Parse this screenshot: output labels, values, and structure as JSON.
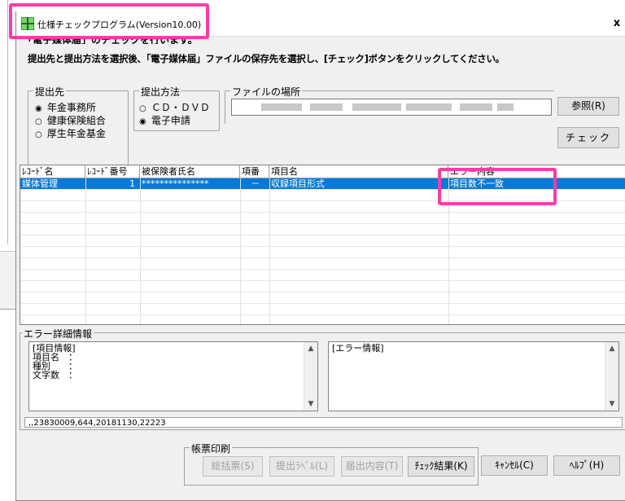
{
  "window": {
    "title": "仕様チェックプログラム(Version10.00)",
    "close_label": "x"
  },
  "description": {
    "line1": "「電子媒体届」のチェックを行います。",
    "line2": "提出先と提出方法を選択後、「電子媒体届」ファイルの保存先を選択し、[チェック]ボタンをクリックしてください。"
  },
  "submit_to": {
    "label": "提出先",
    "options": [
      {
        "label": "年金事務所",
        "selected": true
      },
      {
        "label": "健康保険組合",
        "selected": false
      },
      {
        "label": "厚生年金基金",
        "selected": false
      }
    ]
  },
  "submit_method": {
    "label": "提出方法",
    "options": [
      {
        "label": "ＣＤ・ＤＶＤ",
        "selected": false
      },
      {
        "label": "電子申請",
        "selected": true
      }
    ]
  },
  "file_location": {
    "label": "ファイルの場所",
    "browse_label": "参照(R)"
  },
  "check_button_label": "チェック",
  "table": {
    "headers": [
      "ﾚｺｰﾄﾞ名",
      "ﾚｺｰﾄﾞ番号",
      "被保険者氏名",
      "項番",
      "項目名",
      "エラー内容"
    ],
    "rows": [
      {
        "record_name": "媒体管理",
        "record_no": "1",
        "insured_name": "***************",
        "item_no": "－",
        "item_name": "収録項目形式",
        "error": "項目数不一致"
      }
    ]
  },
  "error_detail": {
    "label": "エラー詳細情報",
    "item_info": [
      "[項目情報]",
      "項目名　：",
      "種別　　：",
      "文字数　："
    ],
    "error_info": "[エラー情報]",
    "status_line": ",,23830009,644,20181130,22223"
  },
  "print": {
    "label": "帳票印刷",
    "summary_label": "総括票(S)",
    "submit_label": "提出ﾗﾍﾞﾙ(L)",
    "content_label": "届出内容(T)"
  },
  "buttons": {
    "check_result_label": "ﾁｪｯｸ結果(K)",
    "cancel_label": "ｷｬﾝｾﾙ(C)",
    "help_label": "ﾍﾙﾌﾟ(H)"
  },
  "colors": {
    "highlight": "#ff3ca6",
    "selection": "#0a78d7"
  }
}
